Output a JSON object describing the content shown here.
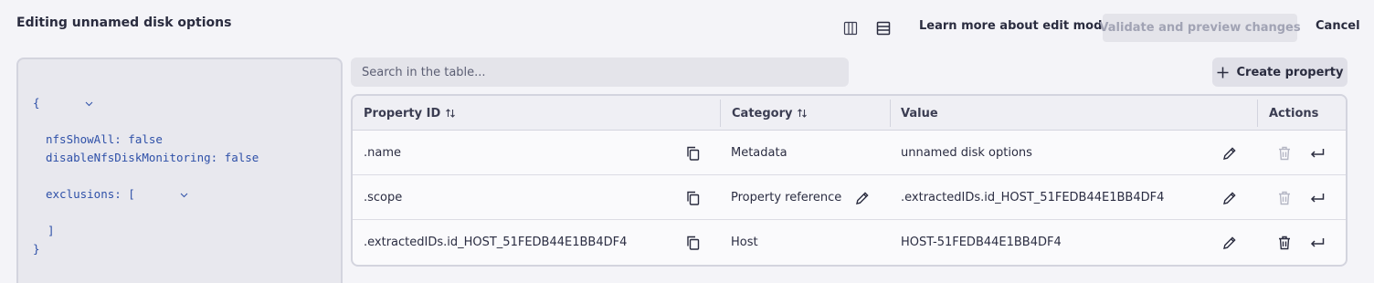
{
  "header": {
    "title": "Editing unnamed disk options",
    "learn_more": "Learn more about edit mode",
    "validate": "Validate and preview changes",
    "cancel": "Cancel"
  },
  "json_editor": {
    "lines": [
      "{",
      "nfsShowAll: false",
      "disableNfsDiskMonitoring: false",
      "exclusions: [",
      "]",
      "}"
    ]
  },
  "search": {
    "placeholder": "Search in the table..."
  },
  "create_property": "Create property",
  "table": {
    "columns": [
      "Property ID",
      "Category",
      "Value",
      "Actions"
    ],
    "rows": [
      {
        "id": ".name",
        "category": "Metadata",
        "value": "unnamed disk options",
        "delete_enabled": false
      },
      {
        "id": ".scope",
        "category": "Property reference",
        "value": ".extractedIDs.id_HOST_51FEDB44E1BB4DF4",
        "delete_enabled": false
      },
      {
        "id": ".extractedIDs.id_HOST_51FEDB44E1BB4DF4",
        "category": "Host",
        "value": "HOST-51FEDB44E1BB4DF4",
        "delete_enabled": true
      }
    ]
  },
  "colors": {
    "accent_text": "#2a2c3f",
    "json_text": "#2e50a8",
    "disabled_icon": "#b4b6c4"
  }
}
